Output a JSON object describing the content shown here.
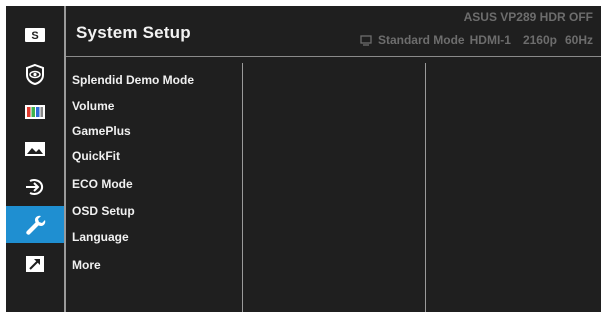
{
  "header": {
    "title": "System Setup",
    "model": "ASUS  VP289 HDR OFF",
    "status": {
      "mode": "Standard Mode",
      "input": "HDMI-1",
      "resolution": "2160p",
      "refresh": "60Hz"
    }
  },
  "sidebar": {
    "items": [
      {
        "icon": "splendid-icon",
        "label": "S"
      },
      {
        "icon": "eye-care-icon"
      },
      {
        "icon": "color-bars-icon"
      },
      {
        "icon": "image-icon"
      },
      {
        "icon": "input-select-icon"
      },
      {
        "icon": "wrench-icon",
        "active": true
      },
      {
        "icon": "shortcut-arrow-icon"
      }
    ]
  },
  "menu": {
    "items": [
      "Splendid Demo Mode",
      "Volume",
      "GamePlus",
      "QuickFit",
      "ECO Mode",
      "OSD Setup",
      "Language",
      "More"
    ]
  },
  "colors": {
    "background": "#1f1f1f",
    "accent": "#1f8fd1",
    "text": "#f0f0f0",
    "muted": "#6d6d6d"
  }
}
